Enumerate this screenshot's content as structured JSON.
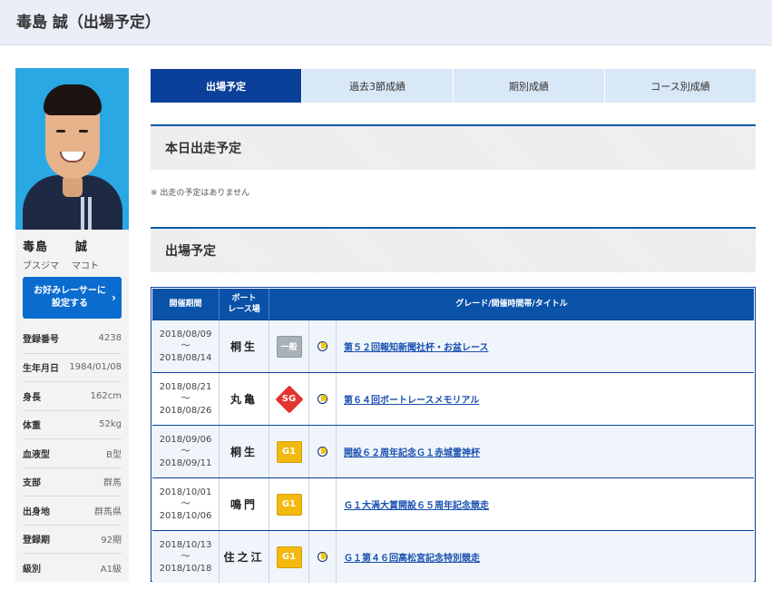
{
  "page": {
    "title": "毒島 誠（出場予定）"
  },
  "racer": {
    "name_family": "毒島",
    "name_given": "誠",
    "kana_family": "ブスジマ",
    "kana_given": "マコト",
    "favorite_line1": "お好みレーサーに",
    "favorite_line2": "設定する",
    "profile": [
      {
        "key": "登録番号",
        "value": "4238"
      },
      {
        "key": "生年月日",
        "value": "1984/01/08"
      },
      {
        "key": "身長",
        "value": "162cm"
      },
      {
        "key": "体重",
        "value": "52kg"
      },
      {
        "key": "血液型",
        "value": "B型"
      },
      {
        "key": "支部",
        "value": "群馬"
      },
      {
        "key": "出身地",
        "value": "群馬県"
      },
      {
        "key": "登録期",
        "value": "92期"
      },
      {
        "key": "級別",
        "value": "A1級"
      }
    ]
  },
  "tabs": [
    {
      "label": "出場予定",
      "active": true
    },
    {
      "label": "過去3節成績",
      "active": false
    },
    {
      "label": "期別成績",
      "active": false
    },
    {
      "label": "コース別成績",
      "active": false
    }
  ],
  "today": {
    "heading": "本日出走予定",
    "note": "※ 出走の予定はありません"
  },
  "schedule": {
    "heading": "出場予定",
    "headers": {
      "period": "開催期間",
      "venue_line1": "ボート",
      "venue_line2": "レース場",
      "info": "グレード/開催時間帯/タイトル"
    },
    "rows": [
      {
        "start": "2018/08/09",
        "sep": "～",
        "end": "2018/08/14",
        "venue": "桐生",
        "grade": "一般",
        "grade_type": "ippan",
        "nighter": true,
        "title": "第５２回報知新聞社杯・お盆レース"
      },
      {
        "start": "2018/08/21",
        "sep": "～",
        "end": "2018/08/26",
        "venue": "丸亀",
        "grade": "SG",
        "grade_type": "sg",
        "nighter": true,
        "title": "第６４回ボートレースメモリアル"
      },
      {
        "start": "2018/09/06",
        "sep": "～",
        "end": "2018/09/11",
        "venue": "桐生",
        "grade": "G1",
        "grade_type": "g1",
        "nighter": true,
        "title": "開設６２周年記念Ｇ１赤城雷神杯"
      },
      {
        "start": "2018/10/01",
        "sep": "～",
        "end": "2018/10/06",
        "venue": "鳴門",
        "grade": "G1",
        "grade_type": "g1",
        "nighter": false,
        "title": "Ｇ１大渦大賞開設６５周年記念競走"
      },
      {
        "start": "2018/10/13",
        "sep": "～",
        "end": "2018/10/18",
        "venue": "住之江",
        "grade": "G1",
        "grade_type": "g1",
        "nighter": true,
        "title": "Ｇ１第４６回高松宮記念特別競走"
      }
    ]
  },
  "colors": {
    "primary": "#0a3f9a",
    "tab_inactive": "#d9e8f7",
    "link": "#1a50b0",
    "favorite_button": "#0a6cce",
    "g1": "#f2b90f",
    "sg": "#e3342f",
    "ippan": "#a8b0b8"
  },
  "icons": {
    "nighter": "nighter-moon-icon",
    "favorite_chevron": "chevron-right-icon"
  }
}
